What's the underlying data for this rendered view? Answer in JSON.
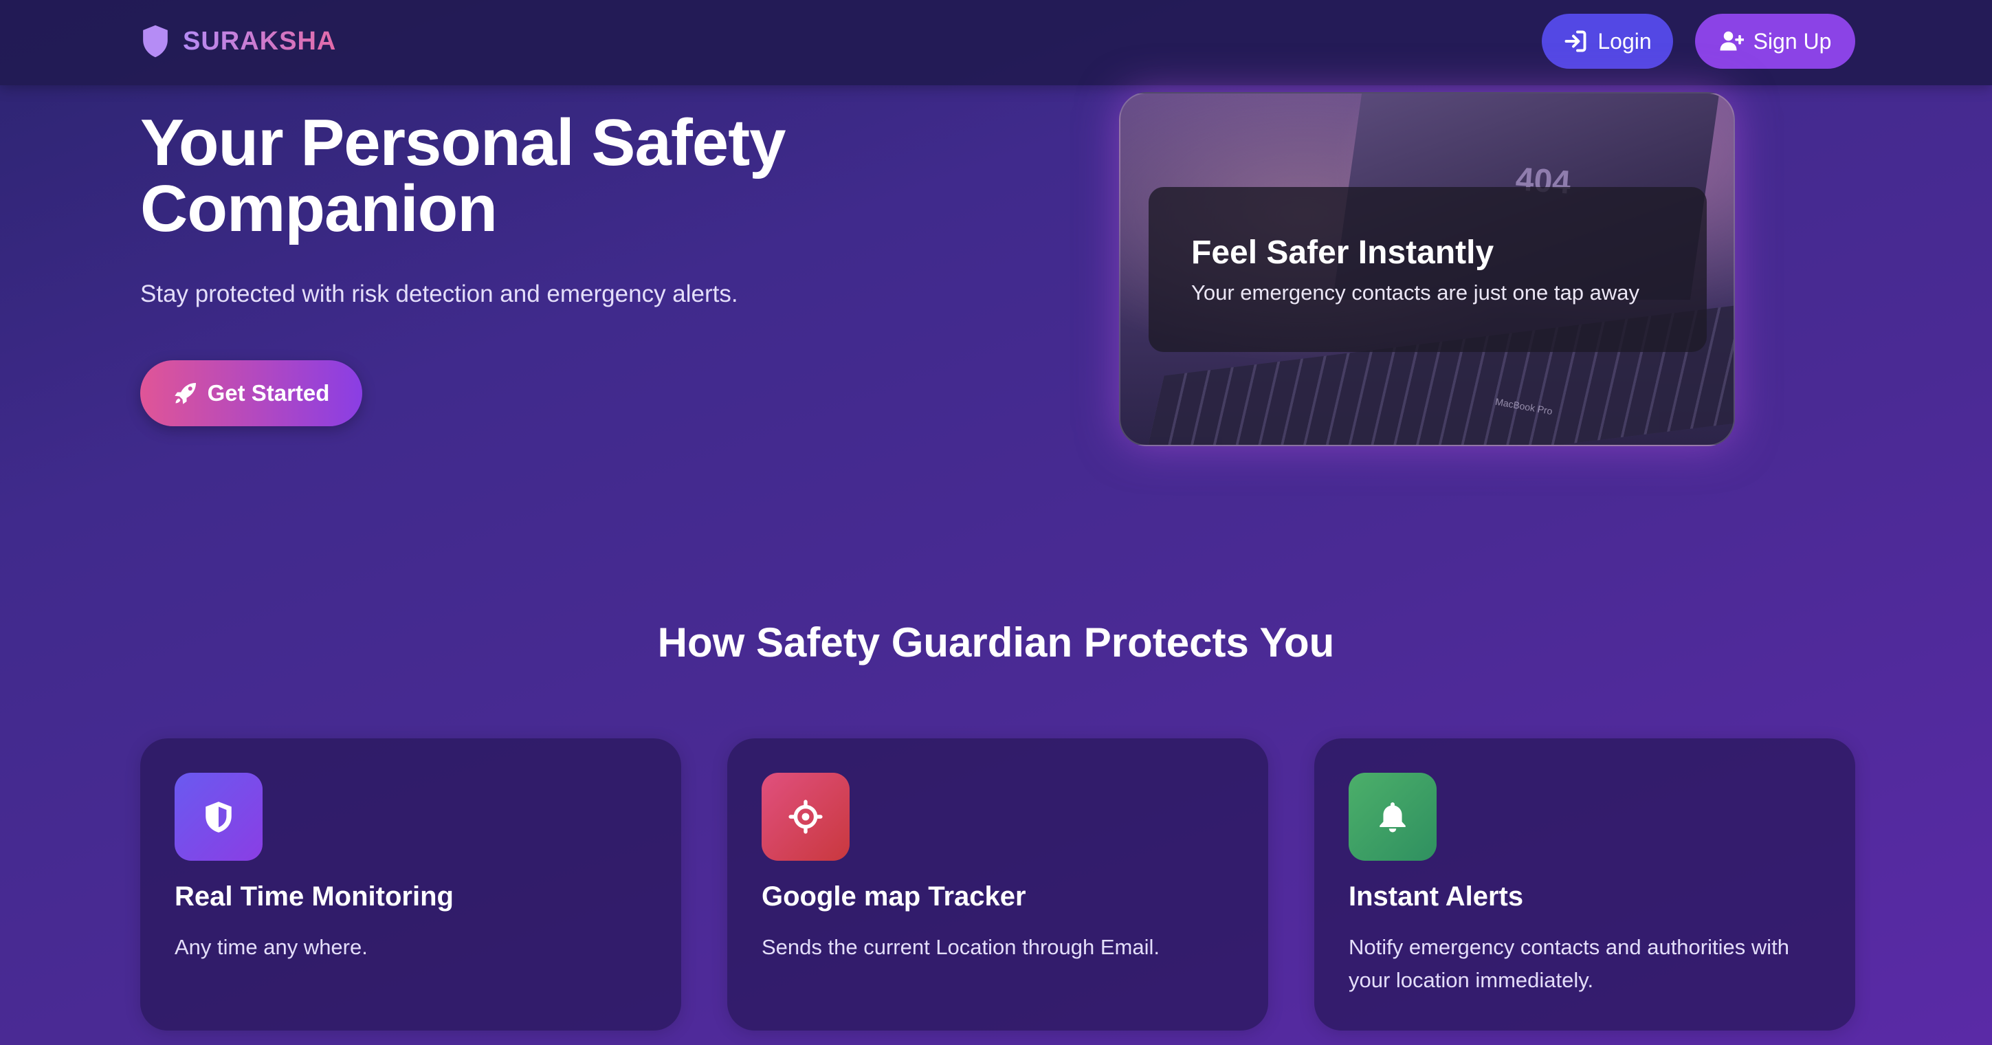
{
  "nav": {
    "brand": "SURAKSHA",
    "login_label": "Login",
    "signup_label": "Sign Up"
  },
  "hero": {
    "title": "Your Personal Safety Companion",
    "subtitle": "Stay protected with risk detection and emergency alerts.",
    "cta_label": "Get Started",
    "card": {
      "screen_text": "404",
      "laptop_brand": "MacBook Pro",
      "title": "Feel Safer Instantly",
      "subtitle": "Your emergency contacts are just one tap away"
    }
  },
  "features": {
    "title": "How Safety Guardian Protects You",
    "items": [
      {
        "icon": "shield-icon",
        "title": "Real Time Monitoring",
        "description": "Any time any where."
      },
      {
        "icon": "crosshair-icon",
        "title": "Google map Tracker",
        "description": "Sends the current Location through Email."
      },
      {
        "icon": "bell-icon",
        "title": "Instant Alerts",
        "description": "Notify emergency contacts and authorities with your location immediately."
      }
    ]
  },
  "colors": {
    "brand_gradient": [
      "#b58cf5",
      "#e46aa8"
    ],
    "login_button": "#5348e4",
    "signup_button": "#8b43e6",
    "cta_gradient": [
      "#e05597",
      "#8a3ee4"
    ]
  }
}
